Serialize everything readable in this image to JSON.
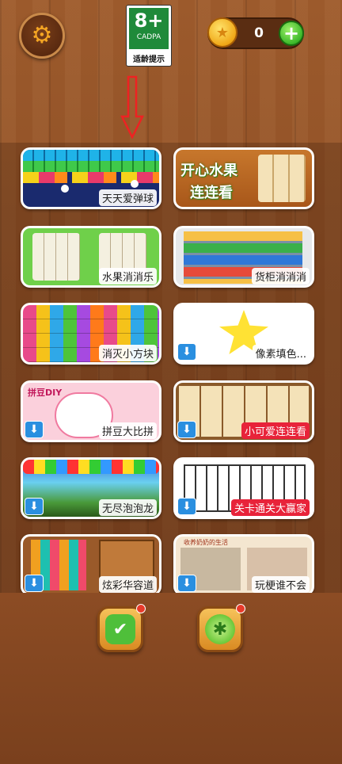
{
  "header": {
    "age_rating": "8+",
    "age_org": "CADPA",
    "age_tip": "适龄提示",
    "coin_count": "0"
  },
  "icons": {
    "settings": "gear-icon",
    "coin": "star-coin-icon",
    "add": "plus-icon",
    "arrow": "down-arrow-icon",
    "download": "download-icon",
    "calendar": "calendar-check-icon",
    "lime": "lime-icon"
  },
  "colors": {
    "wood": "#8e4f25",
    "download_badge": "#2a8fe0",
    "red_label": "#e8233a",
    "notify_dot": "#e83a2a"
  },
  "games": [
    {
      "label": "天天爱弹球",
      "download": false,
      "label_style": "plain"
    },
    {
      "label": "开心水果连连看",
      "download": false,
      "label_style": "none"
    },
    {
      "label": "水果消消乐",
      "download": false,
      "label_style": "plain"
    },
    {
      "label": "货柜消消消",
      "download": false,
      "label_style": "plain"
    },
    {
      "label": "消灭小方块",
      "download": false,
      "label_style": "plain"
    },
    {
      "label": "像素填色...",
      "download": true,
      "label_style": "plain"
    },
    {
      "label": "拼豆大比拼",
      "download": true,
      "label_style": "plain"
    },
    {
      "label": "小可爱连连看",
      "download": true,
      "label_style": "red"
    },
    {
      "label": "无尽泡泡龙",
      "download": true,
      "label_style": "plain"
    },
    {
      "label": "关卡通关大赢家",
      "download": true,
      "label_style": "red"
    },
    {
      "label": "炫彩华容道",
      "download": true,
      "label_style": "plain"
    },
    {
      "label": "玩梗谁不会",
      "download": true,
      "label_style": "plain"
    }
  ],
  "thumb_text": {
    "fruit_title_1": "开心水果",
    "fruit_title_2": "连连看",
    "diy": "拼豆DIY",
    "grandma": "收养奶奶的生活"
  }
}
